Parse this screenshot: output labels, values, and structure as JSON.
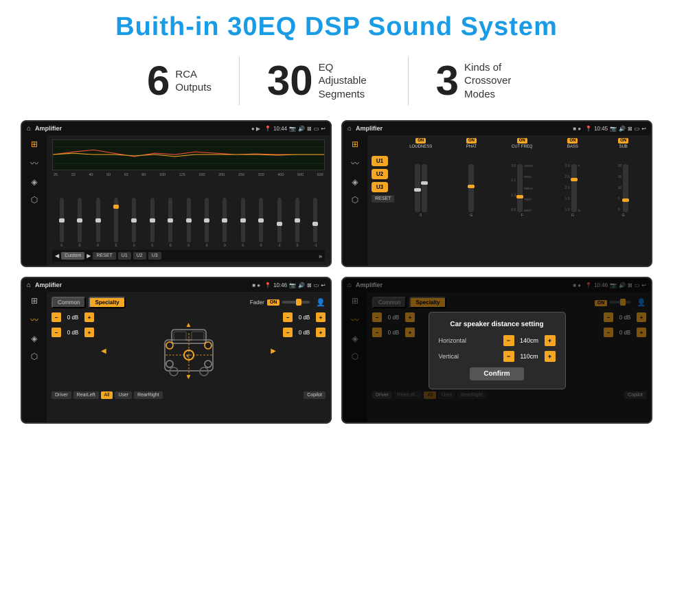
{
  "title": "Buith-in 30EQ DSP Sound System",
  "stats": [
    {
      "number": "6",
      "label": "RCA\nOutputs"
    },
    {
      "number": "30",
      "label": "EQ Adjustable\nSegments"
    },
    {
      "number": "3",
      "label": "Kinds of\nCrossover Modes"
    }
  ],
  "screen1": {
    "appName": "Amplifier",
    "time": "10:44",
    "freqLabels": [
      "25",
      "32",
      "40",
      "50",
      "63",
      "80",
      "100",
      "125",
      "160",
      "200",
      "250",
      "320",
      "400",
      "500",
      "630"
    ],
    "sliderValues": [
      "0",
      "0",
      "0",
      "5",
      "0",
      "0",
      "0",
      "0",
      "0",
      "0",
      "0",
      "0",
      "-1",
      "0",
      "-1"
    ],
    "bottomBtns": [
      "Custom",
      "RESET",
      "U1",
      "U2",
      "U3"
    ]
  },
  "screen2": {
    "appName": "Amplifier",
    "time": "10:45",
    "uButtons": [
      "U1",
      "U2",
      "U3"
    ],
    "controls": [
      {
        "name": "LOUDNESS",
        "on": true
      },
      {
        "name": "PHAT",
        "on": true
      },
      {
        "name": "CUT FREQ",
        "on": true
      },
      {
        "name": "BASS",
        "on": true
      },
      {
        "name": "SUB",
        "on": true
      }
    ],
    "resetLabel": "RESET"
  },
  "screen3": {
    "appName": "Amplifier",
    "time": "10:46",
    "tabs": [
      "Common",
      "Specialty"
    ],
    "activeTab": "Specialty",
    "faderLabel": "Fader",
    "dbValues": [
      "0 dB",
      "0 dB",
      "0 dB",
      "0 dB"
    ],
    "bottomBtns": [
      "Driver",
      "RearLeft",
      "All",
      "User",
      "RearRight",
      "Copilot"
    ]
  },
  "screen4": {
    "appName": "Amplifier",
    "time": "10:46",
    "tabs": [
      "Common",
      "Specialty"
    ],
    "activeTab": "Specialty",
    "dialog": {
      "title": "Car speaker distance setting",
      "horizontal": {
        "label": "Horizontal",
        "value": "140cm"
      },
      "vertical": {
        "label": "Vertical",
        "value": "110cm"
      },
      "confirmBtn": "Confirm"
    },
    "dbValues": [
      "0 dB",
      "0 dB"
    ],
    "bottomBtns": [
      "Driver",
      "RearLeft",
      "All",
      "User",
      "RearRight",
      "Copilot"
    ]
  }
}
